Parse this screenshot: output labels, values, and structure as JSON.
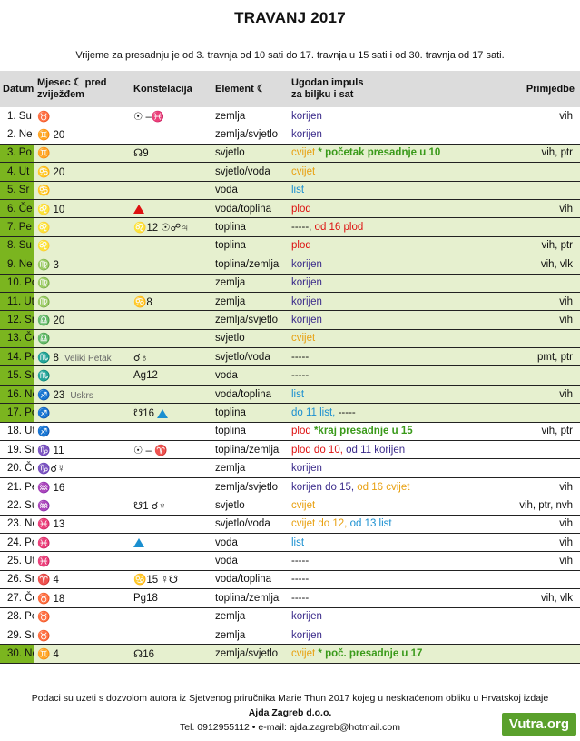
{
  "title": "TRAVANJ 2017",
  "subtitle": "Vrijeme za presadnju je od 3. travnja od 10 sati do 17. travnja u 15 sati i od 30. travnja od 17 sati.",
  "headers": {
    "datum": "Datum",
    "mjesec_line1": "Mjesec ☾ pred",
    "mjesec_line2": "zviježđem",
    "konstelacija": "Konstelacija",
    "element": "Element ☾",
    "ugodan_line1": "Ugodan impuls",
    "ugodan_line2": "za biljku i sat",
    "primjedbe": "Primjedbe"
  },
  "colors": {
    "korijen": "#3a2a8a",
    "cvijet": "#e8a010",
    "list": "#1a8fd0",
    "plod": "#d11111",
    "green_date": "#7bb51f",
    "green_row": "#e6f0cf"
  },
  "rows": [
    {
      "date": "1. Su",
      "moon": "♉",
      "moon_num": "",
      "note": "",
      "konst": "☉ –♓",
      "element": "zemlja",
      "impulse": "korijen",
      "impulse_color": "korijen",
      "extra": "",
      "extra2": "",
      "prim": "vih",
      "style": "w"
    },
    {
      "date": "2. Ne",
      "moon": "♊",
      "moon_num": "20",
      "note": "",
      "konst": "",
      "element": "zemlja/svjetlo",
      "impulse": "korijen",
      "impulse_color": "korijen",
      "extra": "",
      "extra2": "",
      "prim": "",
      "style": "w"
    },
    {
      "date": "3. Po",
      "moon": "♊",
      "moon_num": "",
      "note": "",
      "konst": "☊9",
      "element": "svjetlo",
      "impulse": "cvijet",
      "impulse_color": "cvijet",
      "extra": "* početak presadnje u 10",
      "extra_color": "note-g",
      "extra2": "",
      "prim": "vih, ptr",
      "style": "g"
    },
    {
      "date": "4. Ut",
      "moon": "♋",
      "moon_num": "20",
      "note": "",
      "konst": "",
      "element": "svjetlo/voda",
      "impulse": "cvijet",
      "impulse_color": "cvijet",
      "extra": "",
      "extra2": "",
      "prim": "",
      "style": "g"
    },
    {
      "date": "5. Sr",
      "moon": "♋",
      "moon_num": "",
      "note": "",
      "konst": "",
      "element": "voda",
      "impulse": "list",
      "impulse_color": "list",
      "extra": "",
      "extra2": "",
      "prim": "",
      "style": "g"
    },
    {
      "date": "6. Če",
      "moon": "♌",
      "moon_num": "10",
      "note": "",
      "konst": "▲red",
      "element": "voda/toplina",
      "impulse": "plod",
      "impulse_color": "plod",
      "extra": "",
      "extra2": "",
      "prim": "vih",
      "style": "g"
    },
    {
      "date": "7. Pe",
      "moon": "♌",
      "moon_num": "",
      "note": "",
      "konst": "♌12 ☉☍♃",
      "element": "toplina",
      "impulse": "-----,",
      "impulse_color": "note-d",
      "extra": "od 16 plod",
      "extra_color": "plod",
      "extra2": "",
      "prim": "",
      "style": "g"
    },
    {
      "date": "8. Su",
      "moon": "♌",
      "moon_num": "",
      "note": "",
      "konst": "",
      "element": "toplina",
      "impulse": "plod",
      "impulse_color": "plod",
      "extra": "",
      "extra2": "",
      "prim": "vih, ptr",
      "style": "g"
    },
    {
      "date": "9. Ne",
      "moon": "♍",
      "moon_num": "3",
      "note": "",
      "konst": "",
      "element": "toplina/zemlja",
      "impulse": "korijen",
      "impulse_color": "korijen",
      "extra": "",
      "extra2": "",
      "prim": "vih, vlk",
      "style": "g"
    },
    {
      "date": "10. Po",
      "moon": "♍",
      "moon_num": "",
      "note": "",
      "konst": "",
      "element": "zemlja",
      "impulse": "korijen",
      "impulse_color": "korijen",
      "extra": "",
      "extra2": "",
      "prim": "",
      "style": "g"
    },
    {
      "date": "11. Ut",
      "moon": "♍",
      "moon_num": "",
      "note": "",
      "konst": "♋8",
      "element": "zemlja",
      "impulse": "korijen",
      "impulse_color": "korijen",
      "extra": "",
      "extra2": "",
      "prim": "vih",
      "style": "g"
    },
    {
      "date": "12. Sr",
      "moon": "♎",
      "moon_num": "20",
      "note": "",
      "konst": "",
      "element": "zemlja/svjetlo",
      "impulse": "korijen",
      "impulse_color": "korijen",
      "extra": "",
      "extra2": "",
      "prim": "vih",
      "style": "g"
    },
    {
      "date": "13. Če",
      "moon": "♎",
      "moon_num": "",
      "note": "",
      "konst": "",
      "element": "svjetlo",
      "impulse": "cvijet",
      "impulse_color": "cvijet",
      "extra": "",
      "extra2": "",
      "prim": "",
      "style": "g"
    },
    {
      "date": "14. Pe",
      "moon": "♏",
      "moon_num": "8",
      "note": "Veliki Petak",
      "konst": "☌♁",
      "element": "svjetlo/voda",
      "impulse": "-----",
      "impulse_color": "note-d",
      "extra": "",
      "extra2": "",
      "prim": "pmt, ptr",
      "style": "g"
    },
    {
      "date": "15. Su",
      "moon": "♏",
      "moon_num": "",
      "note": "",
      "konst": "Ag12",
      "element": "voda",
      "impulse": "-----",
      "impulse_color": "note-d",
      "extra": "",
      "extra2": "",
      "prim": "",
      "style": "g"
    },
    {
      "date": "16. Ne",
      "moon": "♐",
      "moon_num": "23",
      "note": "Uskrs",
      "konst": "",
      "element": "voda/toplina",
      "impulse": "list",
      "impulse_color": "list",
      "extra": "",
      "extra2": "",
      "prim": "vih",
      "style": "g"
    },
    {
      "date": "17. Po",
      "moon": "♐",
      "moon_num": "",
      "note": "",
      "konst": "☋16 ▲blue",
      "element": "toplina",
      "impulse": "do 11 list,",
      "impulse_color": "list",
      "extra": "-----",
      "extra_color": "note-d",
      "extra2": "",
      "prim": "",
      "style": "g"
    },
    {
      "date": "18. Ut",
      "moon": "♐",
      "moon_num": "",
      "note": "",
      "konst": "",
      "element": "toplina",
      "impulse": "plod",
      "impulse_color": "plod",
      "extra": "*kraj presadnje u 15",
      "extra_color": "note-g",
      "extra2": "",
      "prim": "vih, ptr",
      "style": "w"
    },
    {
      "date": "19. Sr",
      "moon": "♑",
      "moon_num": "11",
      "note": "",
      "konst": "☉ – ♈",
      "element": "toplina/zemlja",
      "impulse": "plod do 10,",
      "impulse_color": "plod",
      "extra": "od 11 korijen",
      "extra_color": "korijen",
      "extra2": "",
      "prim": "",
      "style": "w"
    },
    {
      "date": "20. Če",
      "moon": "♑☌☿",
      "moon_num": "",
      "note": "",
      "konst": "",
      "element": "zemlja",
      "impulse": "korijen",
      "impulse_color": "korijen",
      "extra": "",
      "extra2": "",
      "prim": "",
      "style": "w"
    },
    {
      "date": "21. Pe",
      "moon": "♒",
      "moon_num": "16",
      "note": "",
      "konst": "",
      "element": "zemlja/svjetlo",
      "impulse": "korijen do 15,",
      "impulse_color": "korijen",
      "extra": "od 16 cvijet",
      "extra_color": "cvijet",
      "extra2": "",
      "prim": "vih",
      "style": "w"
    },
    {
      "date": "22. Su",
      "moon": "♒",
      "moon_num": "",
      "note": "",
      "konst": "☋1      ☌♆",
      "element": "svjetlo",
      "impulse": "cvijet",
      "impulse_color": "cvijet",
      "extra": "",
      "extra2": "",
      "prim": "vih, ptr, nvh",
      "style": "w"
    },
    {
      "date": "23. Ne",
      "moon": "♓",
      "moon_num": "13",
      "note": "",
      "konst": "",
      "element": "svjetlo/voda",
      "impulse": "cvijet do 12,",
      "impulse_color": "cvijet",
      "extra": "od 13 list",
      "extra_color": "list",
      "extra2": "",
      "prim": "vih",
      "style": "w"
    },
    {
      "date": "24. Po",
      "moon": "♓",
      "moon_num": "",
      "note": "",
      "konst": "▲blue",
      "element": "voda",
      "impulse": "list",
      "impulse_color": "list",
      "extra": "",
      "extra2": "",
      "prim": "vih",
      "style": "w"
    },
    {
      "date": "25. Ut",
      "moon": "♓",
      "moon_num": "",
      "note": "",
      "konst": "",
      "element": "voda",
      "impulse": "-----",
      "impulse_color": "note-d",
      "extra": "",
      "extra2": "",
      "prim": "vih",
      "style": "w"
    },
    {
      "date": "26. Sr",
      "moon": "♈",
      "moon_num": "4",
      "note": "",
      "konst": "♋15   ☿☋",
      "element": "voda/toplina",
      "impulse": "-----",
      "impulse_color": "note-d",
      "extra": "",
      "extra2": "",
      "prim": "",
      "style": "w"
    },
    {
      "date": "27. Če",
      "moon": "♉",
      "moon_num": "18",
      "note": "",
      "konst": "Pg18",
      "element": "toplina/zemlja",
      "impulse": "-----",
      "impulse_color": "note-d",
      "extra": "",
      "extra2": "",
      "prim": "vih, vlk",
      "style": "w"
    },
    {
      "date": "28. Pe",
      "moon": "♉",
      "moon_num": "",
      "note": "",
      "konst": "",
      "element": "zemlja",
      "impulse": "korijen",
      "impulse_color": "korijen",
      "extra": "",
      "extra2": "",
      "prim": "",
      "style": "w"
    },
    {
      "date": "29. Su",
      "moon": "♉",
      "moon_num": "",
      "note": "",
      "konst": "",
      "element": "zemlja",
      "impulse": "korijen",
      "impulse_color": "korijen",
      "extra": "",
      "extra2": "",
      "prim": "",
      "style": "w"
    },
    {
      "date": "30. Ne",
      "moon": "♊",
      "moon_num": "4",
      "note": "",
      "konst": "☊16",
      "element": "zemlja/svjetlo",
      "impulse": "cvijet",
      "impulse_color": "cvijet",
      "extra": "* poč. presadnje u 17",
      "extra_color": "note-g",
      "extra2": "",
      "prim": "",
      "style": "g"
    }
  ],
  "footer": {
    "line1": "Podaci su uzeti s dozvolom autora iz Sjetvenog priručnika Marie Thun 2017 kojeg u  neskraćenom obliku u Hrvatskoj izdaje",
    "line2": "Ajda Zagreb d.o.o.",
    "line3": "Tel. 0912955112  •  e-mail: ajda.zagreb@hotmail.com"
  },
  "watermark": "Vutra.org"
}
